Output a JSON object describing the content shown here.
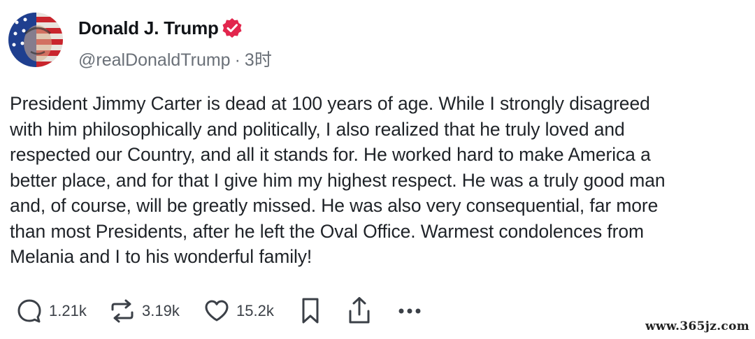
{
  "author": {
    "display_name": "Donald J. Trump",
    "handle": "@realDonaldTrump",
    "time": "3时"
  },
  "post": {
    "text": "President Jimmy Carter is dead at 100 years of age. While I strongly disagreed\nwith him philosophically and politically, I also realized that he truly loved and\nrespected our Country, and all it stands for. He worked hard to make America a\nbetter place, and for that I give him my highest respect. He was a truly good man\nand, of course, will be greatly missed. He was also very consequential, far more\nthan most Presidents, after he left the Oval Office. Warmest condolences from\nMelania and I to his wonderful family!"
  },
  "actions": {
    "replies": "1.21k",
    "retruths": "3.19k",
    "likes": "15.2k"
  },
  "icons": [
    "avatar",
    "verified-badge-icon",
    "reply-icon",
    "retruth-icon",
    "like-icon",
    "bookmark-icon",
    "share-icon",
    "more-icon"
  ],
  "colors": {
    "verified": "#e2264d",
    "text": "#1f2328",
    "muted": "#6a7078"
  },
  "watermark": "www.365jz.com"
}
